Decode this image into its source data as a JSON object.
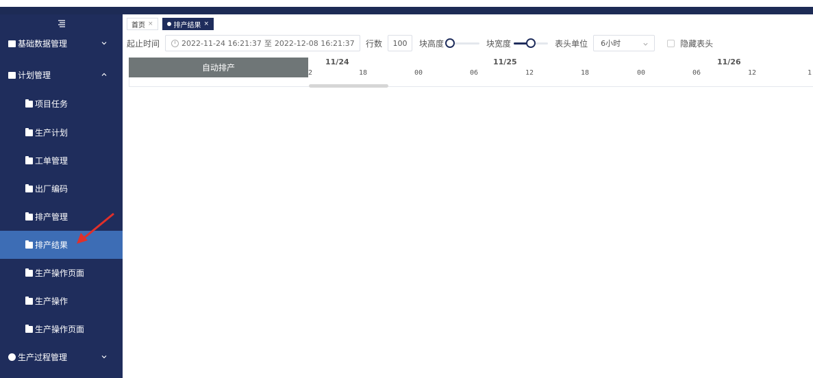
{
  "sidebar": {
    "items": [
      {
        "label": "基础数据管理",
        "type": "top",
        "expanded": false
      },
      {
        "label": "计划管理",
        "type": "top",
        "expanded": true
      },
      {
        "label": "项目任务",
        "type": "sub"
      },
      {
        "label": "生产计划",
        "type": "sub"
      },
      {
        "label": "工单管理",
        "type": "sub"
      },
      {
        "label": "出厂编码",
        "type": "sub"
      },
      {
        "label": "排产管理",
        "type": "sub"
      },
      {
        "label": "排产结果",
        "type": "sub",
        "active": true
      },
      {
        "label": "生产操作页面",
        "type": "sub"
      },
      {
        "label": "生产操作",
        "type": "sub"
      },
      {
        "label": "生产操作页面",
        "type": "sub"
      },
      {
        "label": "生产过程管理",
        "type": "top",
        "expanded": false
      }
    ]
  },
  "tabs": [
    {
      "label": "首页",
      "close": "×"
    },
    {
      "label": "排产结果",
      "close": "×",
      "active": true
    }
  ],
  "toolbar": {
    "time_label": "起止时间",
    "start_time": "2022-11-24 16:21:37",
    "range_sep": "至",
    "end_time": "2022-12-08 16:21:37",
    "rows_label": "行数",
    "rows_value": "100",
    "block_height_label": "块高度",
    "block_height_value": 0,
    "block_width_label": "块宽度",
    "block_width_value": 0.5,
    "header_unit_label": "表头单位",
    "header_unit_value": "6小时",
    "hide_header_label": "隐藏表头"
  },
  "gantt": {
    "header": "自动排产",
    "days": [
      "11/24",
      "11/25",
      "11/26"
    ],
    "hours": [
      "2",
      "18",
      "00",
      "06",
      "12",
      "18",
      "00",
      "06",
      "12",
      "1"
    ]
  },
  "colors": {
    "sidebar_bg": "#1f2d5c",
    "active_item": "#3d6db5",
    "annotation_arrow": "#e0302a"
  }
}
